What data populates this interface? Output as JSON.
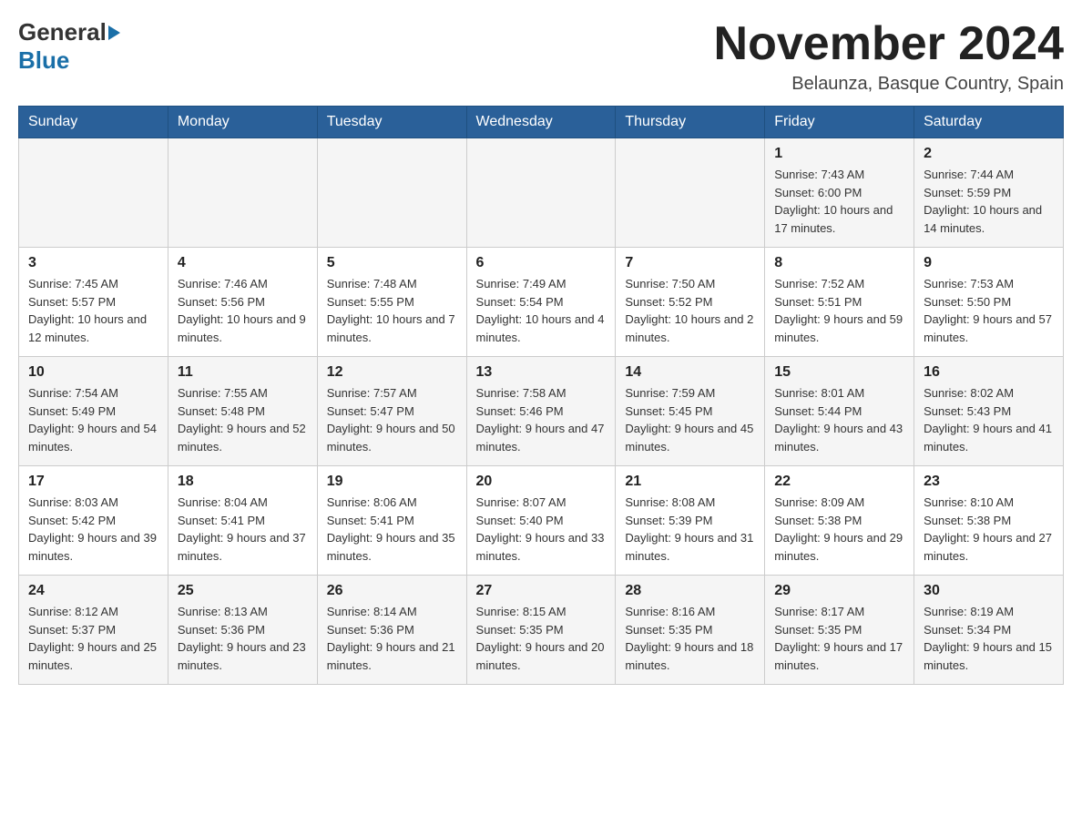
{
  "header": {
    "month_title": "November 2024",
    "location": "Belaunza, Basque Country, Spain",
    "logo_general": "General",
    "logo_blue": "Blue"
  },
  "days_of_week": [
    "Sunday",
    "Monday",
    "Tuesday",
    "Wednesday",
    "Thursday",
    "Friday",
    "Saturday"
  ],
  "weeks": [
    [
      {
        "day": "",
        "info": ""
      },
      {
        "day": "",
        "info": ""
      },
      {
        "day": "",
        "info": ""
      },
      {
        "day": "",
        "info": ""
      },
      {
        "day": "",
        "info": ""
      },
      {
        "day": "1",
        "info": "Sunrise: 7:43 AM\nSunset: 6:00 PM\nDaylight: 10 hours and 17 minutes."
      },
      {
        "day": "2",
        "info": "Sunrise: 7:44 AM\nSunset: 5:59 PM\nDaylight: 10 hours and 14 minutes."
      }
    ],
    [
      {
        "day": "3",
        "info": "Sunrise: 7:45 AM\nSunset: 5:57 PM\nDaylight: 10 hours and 12 minutes."
      },
      {
        "day": "4",
        "info": "Sunrise: 7:46 AM\nSunset: 5:56 PM\nDaylight: 10 hours and 9 minutes."
      },
      {
        "day": "5",
        "info": "Sunrise: 7:48 AM\nSunset: 5:55 PM\nDaylight: 10 hours and 7 minutes."
      },
      {
        "day": "6",
        "info": "Sunrise: 7:49 AM\nSunset: 5:54 PM\nDaylight: 10 hours and 4 minutes."
      },
      {
        "day": "7",
        "info": "Sunrise: 7:50 AM\nSunset: 5:52 PM\nDaylight: 10 hours and 2 minutes."
      },
      {
        "day": "8",
        "info": "Sunrise: 7:52 AM\nSunset: 5:51 PM\nDaylight: 9 hours and 59 minutes."
      },
      {
        "day": "9",
        "info": "Sunrise: 7:53 AM\nSunset: 5:50 PM\nDaylight: 9 hours and 57 minutes."
      }
    ],
    [
      {
        "day": "10",
        "info": "Sunrise: 7:54 AM\nSunset: 5:49 PM\nDaylight: 9 hours and 54 minutes."
      },
      {
        "day": "11",
        "info": "Sunrise: 7:55 AM\nSunset: 5:48 PM\nDaylight: 9 hours and 52 minutes."
      },
      {
        "day": "12",
        "info": "Sunrise: 7:57 AM\nSunset: 5:47 PM\nDaylight: 9 hours and 50 minutes."
      },
      {
        "day": "13",
        "info": "Sunrise: 7:58 AM\nSunset: 5:46 PM\nDaylight: 9 hours and 47 minutes."
      },
      {
        "day": "14",
        "info": "Sunrise: 7:59 AM\nSunset: 5:45 PM\nDaylight: 9 hours and 45 minutes."
      },
      {
        "day": "15",
        "info": "Sunrise: 8:01 AM\nSunset: 5:44 PM\nDaylight: 9 hours and 43 minutes."
      },
      {
        "day": "16",
        "info": "Sunrise: 8:02 AM\nSunset: 5:43 PM\nDaylight: 9 hours and 41 minutes."
      }
    ],
    [
      {
        "day": "17",
        "info": "Sunrise: 8:03 AM\nSunset: 5:42 PM\nDaylight: 9 hours and 39 minutes."
      },
      {
        "day": "18",
        "info": "Sunrise: 8:04 AM\nSunset: 5:41 PM\nDaylight: 9 hours and 37 minutes."
      },
      {
        "day": "19",
        "info": "Sunrise: 8:06 AM\nSunset: 5:41 PM\nDaylight: 9 hours and 35 minutes."
      },
      {
        "day": "20",
        "info": "Sunrise: 8:07 AM\nSunset: 5:40 PM\nDaylight: 9 hours and 33 minutes."
      },
      {
        "day": "21",
        "info": "Sunrise: 8:08 AM\nSunset: 5:39 PM\nDaylight: 9 hours and 31 minutes."
      },
      {
        "day": "22",
        "info": "Sunrise: 8:09 AM\nSunset: 5:38 PM\nDaylight: 9 hours and 29 minutes."
      },
      {
        "day": "23",
        "info": "Sunrise: 8:10 AM\nSunset: 5:38 PM\nDaylight: 9 hours and 27 minutes."
      }
    ],
    [
      {
        "day": "24",
        "info": "Sunrise: 8:12 AM\nSunset: 5:37 PM\nDaylight: 9 hours and 25 minutes."
      },
      {
        "day": "25",
        "info": "Sunrise: 8:13 AM\nSunset: 5:36 PM\nDaylight: 9 hours and 23 minutes."
      },
      {
        "day": "26",
        "info": "Sunrise: 8:14 AM\nSunset: 5:36 PM\nDaylight: 9 hours and 21 minutes."
      },
      {
        "day": "27",
        "info": "Sunrise: 8:15 AM\nSunset: 5:35 PM\nDaylight: 9 hours and 20 minutes."
      },
      {
        "day": "28",
        "info": "Sunrise: 8:16 AM\nSunset: 5:35 PM\nDaylight: 9 hours and 18 minutes."
      },
      {
        "day": "29",
        "info": "Sunrise: 8:17 AM\nSunset: 5:35 PM\nDaylight: 9 hours and 17 minutes."
      },
      {
        "day": "30",
        "info": "Sunrise: 8:19 AM\nSunset: 5:34 PM\nDaylight: 9 hours and 15 minutes."
      }
    ]
  ]
}
